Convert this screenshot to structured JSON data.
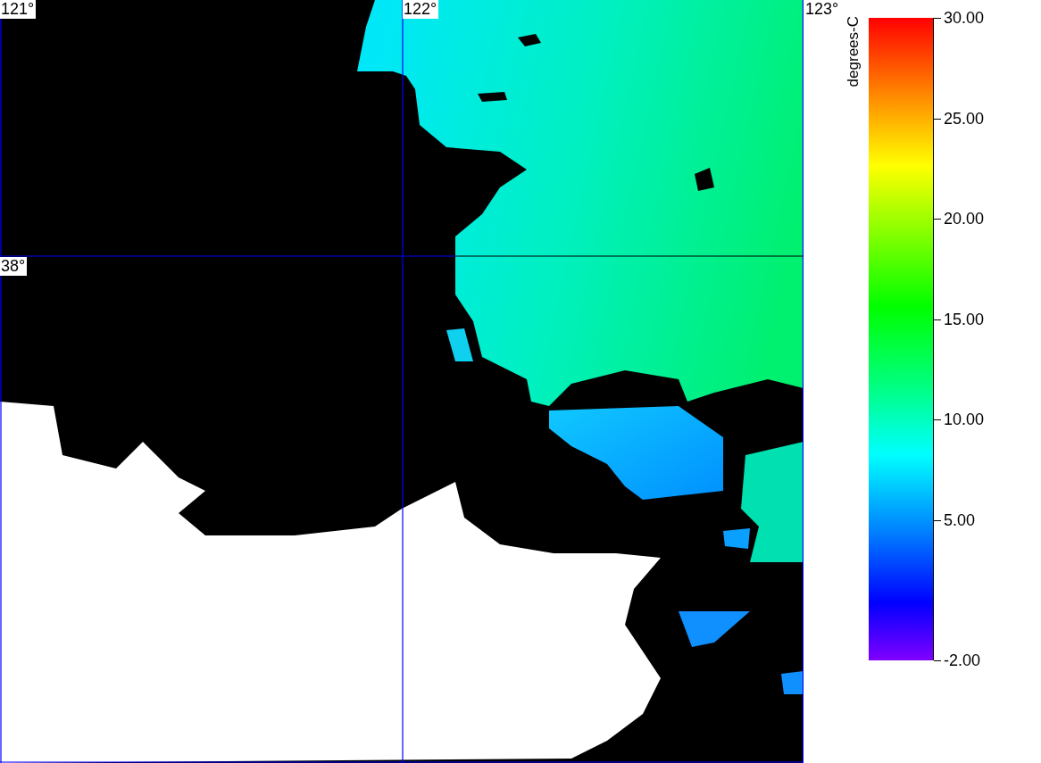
{
  "map": {
    "longitude_labels": [
      "121°",
      "122°",
      "123°"
    ],
    "latitude_labels": [
      "38°"
    ]
  },
  "colorbar": {
    "title": "degrees-C",
    "ticks": [
      {
        "label": "30.00"
      },
      {
        "label": "25.00"
      },
      {
        "label": "20.00"
      },
      {
        "label": "15.00"
      },
      {
        "label": "10.00"
      },
      {
        "label": "5.00"
      },
      {
        "label": "-2.00"
      }
    ]
  }
}
